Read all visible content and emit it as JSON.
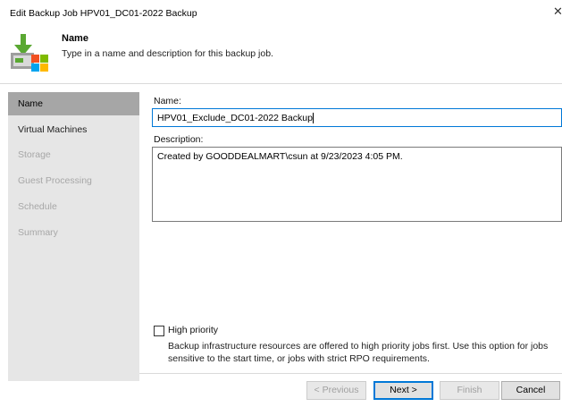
{
  "window": {
    "title": "Edit Backup Job HPV01_DC01-2022 Backup"
  },
  "header": {
    "title": "Name",
    "description": "Type in a name and description for this backup job."
  },
  "sidebar": {
    "items": [
      {
        "label": "Name",
        "state": "active"
      },
      {
        "label": "Virtual Machines",
        "state": "done"
      },
      {
        "label": "Storage",
        "state": "disabled"
      },
      {
        "label": "Guest Processing",
        "state": "disabled"
      },
      {
        "label": "Schedule",
        "state": "disabled"
      },
      {
        "label": "Summary",
        "state": "disabled"
      }
    ]
  },
  "form": {
    "name_label": "Name:",
    "name_value": "HPV01_Exclude_DC01-2022 Backup",
    "description_label": "Description:",
    "description_value": "Created by GOODDEALMART\\csun at 9/23/2023 4:05 PM.",
    "high_priority": {
      "label": "High priority",
      "checked": false,
      "note": "Backup infrastructure resources are offered to high priority jobs first. Use this option for jobs sensitive to the start time, or jobs with strict RPO requirements."
    }
  },
  "buttons": {
    "previous": "< Previous",
    "next": "Next >",
    "finish": "Finish",
    "cancel": "Cancel"
  },
  "colors": {
    "sidebar_bg": "#e6e6e6",
    "sidebar_active": "#a6a6a6",
    "focus_border": "#0078d7",
    "logo_green": "#5aa832"
  },
  "icons": {
    "header_logo": "veeam-backup-job-icon",
    "close": "close-icon",
    "checkbox": "checkbox-icon"
  }
}
